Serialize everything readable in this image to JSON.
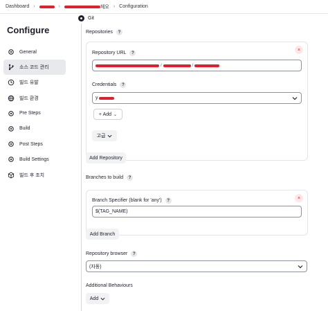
{
  "breadcrumb": {
    "items": [
      "Dashboard",
      "Configuration"
    ],
    "partial_suffix": "체오"
  },
  "page": {
    "title": "Configure"
  },
  "sidebar": {
    "items": [
      {
        "label": "General",
        "icon": "gear-icon"
      },
      {
        "label": "소스 코드 관리",
        "icon": "branch-icon",
        "active": true
      },
      {
        "label": "빌드 유발",
        "icon": "clock-icon"
      },
      {
        "label": "빌드 환경",
        "icon": "globe-icon"
      },
      {
        "label": "Pre Steps",
        "icon": "gear-icon"
      },
      {
        "label": "Build",
        "icon": "gear-icon"
      },
      {
        "label": "Post Steps",
        "icon": "gear-icon"
      },
      {
        "label": "Build Settings",
        "icon": "gear-icon"
      },
      {
        "label": "빌드 후 조치",
        "icon": "cube-icon"
      }
    ]
  },
  "scm": {
    "option_label": "Git"
  },
  "repositories": {
    "label": "Repositories",
    "url_label": "Repository URL",
    "credentials_label": "Credentials",
    "credentials_value_prefix": "y",
    "add_credential_label": "+ Add",
    "advanced_label": "고급",
    "add_repository_label": "Add Repository"
  },
  "branches": {
    "label": "Branches to build",
    "specifier_label": "Branch Specifier (blank for 'any')",
    "specifier_value": "$(TAG_NAME)",
    "add_branch_label": "Add Branch"
  },
  "browser": {
    "label": "Repository browser",
    "value": "(자동)"
  },
  "behaviours": {
    "label": "Additional Behaviours",
    "add_label": "Add"
  },
  "help_glyph": "?",
  "close_glyph": "×",
  "colors": {
    "accent": "#1d1f2c",
    "redaction": "#e0202a",
    "nav_active_bg": "#e8e9ed"
  }
}
